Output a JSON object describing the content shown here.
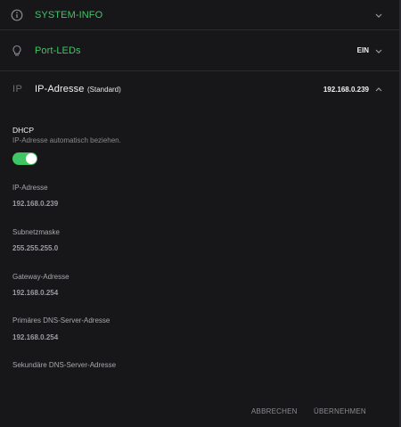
{
  "rows": {
    "system_info": {
      "title": "SYSTEM-INFO",
      "icon": "info-icon"
    },
    "port_leds": {
      "title": "Port-LEDs",
      "value": "EIN",
      "icon": "lightbulb-icon"
    },
    "ip_address": {
      "icon_text": "IP",
      "title": "IP-Adresse",
      "badge": "(Standard)",
      "value": "192.168.0.239"
    }
  },
  "dhcp": {
    "title": "DHCP",
    "description": "IP-Adresse automatisch beziehen.",
    "enabled": true
  },
  "fields": [
    {
      "label": "IP-Adresse",
      "value": "192.168.0.239"
    },
    {
      "label": "Subnetzmaske",
      "value": "255.255.255.0"
    },
    {
      "label": "Gateway-Adresse",
      "value": "192.168.0.254"
    },
    {
      "label": "Primäres DNS-Server-Adresse",
      "value": "192.168.0.254"
    },
    {
      "label": "Sekundäre DNS-Server-Adresse",
      "value": ""
    }
  ],
  "footer": {
    "cancel_label": "ABBRECHEN",
    "apply_label": "ÜBERNEHMEN"
  },
  "colors": {
    "accent": "#3fc564",
    "background": "#171719"
  }
}
